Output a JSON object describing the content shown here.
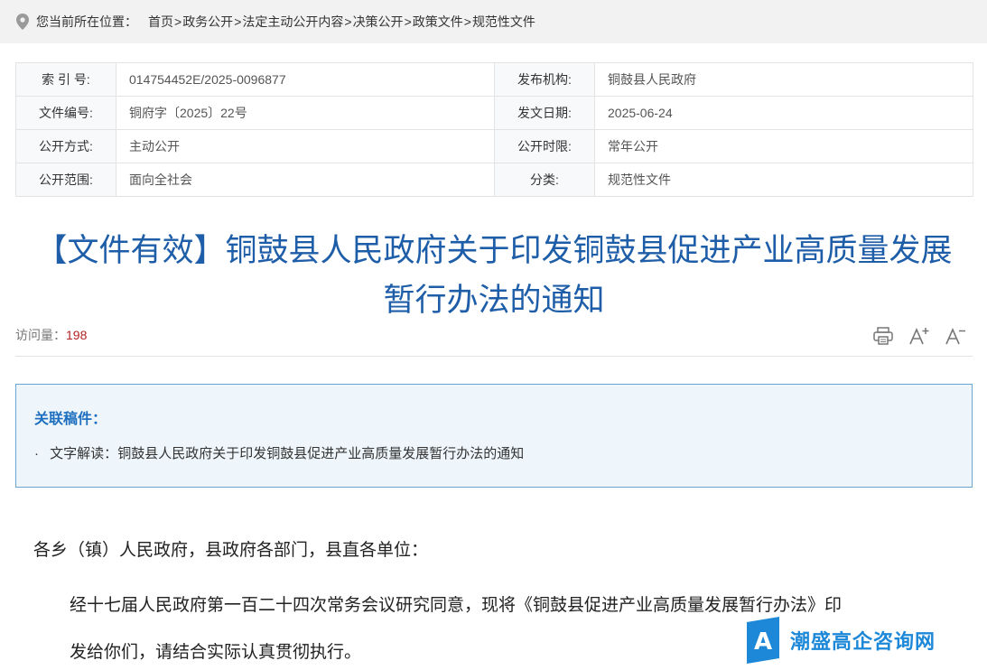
{
  "breadcrumb": {
    "prefix": "您当前所在位置：",
    "items": [
      "首页",
      "政务公开",
      "法定主动公开内容",
      "决策公开",
      "政策文件",
      "规范性文件"
    ],
    "separator": ">"
  },
  "meta": {
    "rows": [
      {
        "k1": "索 引 号:",
        "v1": "014754452E/2025-0096877",
        "k2": "发布机构:",
        "v2": "铜鼓县人民政府"
      },
      {
        "k1": "文件编号:",
        "v1": "铜府字〔2025〕22号",
        "k2": "发文日期:",
        "v2": "2025-06-24"
      },
      {
        "k1": "公开方式:",
        "v1": "主动公开",
        "k2": "公开时限:",
        "v2": "常年公开"
      },
      {
        "k1": "公开范围:",
        "v1": "面向全社会",
        "k2": "分类:",
        "v2": "规范性文件"
      }
    ]
  },
  "title": {
    "line1": "【文件有效】铜鼓县人民政府关于印发铜鼓县促进产业高质量发展",
    "line2": "暂行办法的通知"
  },
  "stats": {
    "visits_label": "访问量：",
    "visits_value": "198"
  },
  "tools": {
    "print_icon": "printer-icon",
    "font_up_icon": "font-increase-icon",
    "font_down_icon": "font-decrease-icon"
  },
  "related": {
    "title": "关联稿件：",
    "item_bullet": "·",
    "item_label": "文字解读：",
    "item_link": "铜鼓县人民政府关于印发铜鼓县促进产业高质量发展暂行办法的通知"
  },
  "body": {
    "p1": "各乡（镇）人民政府，县政府各部门，县直各单位：",
    "p2": "经十七届人民政府第一百二十四次常务会议研究同意，现将《铜鼓县促进产业高质量发展暂行办法》印",
    "p3": "发给你们，请结合实际认真贯彻执行。"
  },
  "watermark": {
    "logo_letter": "A",
    "text": "潮盛高企咨询网"
  },
  "colors": {
    "title_blue": "#1e5da8",
    "related_border": "#6aa6cf",
    "related_bg": "#eef6fb",
    "visits_red": "#b22222"
  }
}
